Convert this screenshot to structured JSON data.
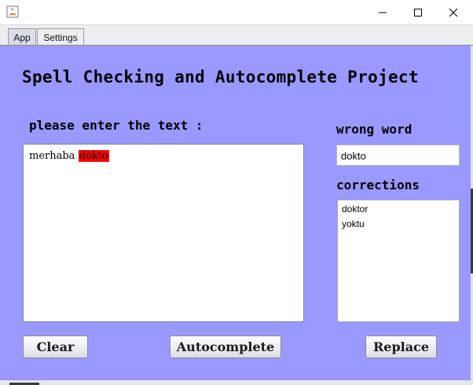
{
  "window": {
    "icon": "java-icon",
    "controls": [
      "minimize-icon",
      "maximize-icon",
      "close-icon"
    ]
  },
  "tabs": [
    {
      "label": "App",
      "selected": true
    },
    {
      "label": "Settings",
      "selected": false
    }
  ],
  "main": {
    "title": "Spell Checking and Autocomplete Project",
    "prompt_label": "please enter the text :",
    "text_area": {
      "text_before": "merhaba ",
      "highlighted_word": "dokto",
      "highlight_color": "#ff0000"
    },
    "wrong_word": {
      "label": "wrong word",
      "value": "dokto"
    },
    "corrections": {
      "label": "corrections",
      "items": [
        "doktor",
        "yoktu"
      ]
    },
    "buttons": {
      "clear": "Clear",
      "autocomplete": "Autocomplete",
      "replace": "Replace"
    }
  },
  "colors": {
    "panel_background": "#9999ff",
    "highlight": "#ff0000"
  }
}
